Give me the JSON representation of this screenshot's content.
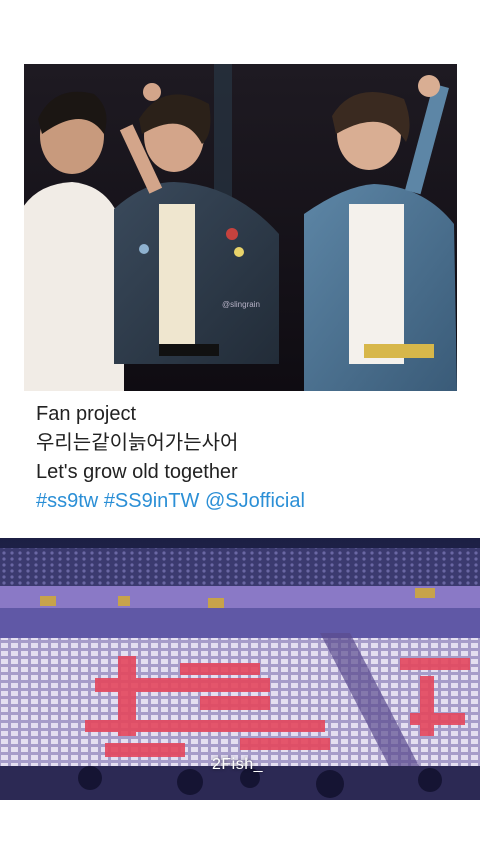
{
  "caption": {
    "line1": "Fan project",
    "line2": "우리는같이늙어가는사어",
    "line3": "Let's grow old together",
    "tags": [
      "#ss9tw",
      "#SS9inTW",
      "@SJofficial"
    ]
  },
  "photos": {
    "top_watermark": "@slingrain",
    "bottom_watermark": "2Fish_"
  },
  "colors": {
    "hashtag": "#2b8fd6",
    "text": "#222222",
    "background": "#ffffff"
  }
}
